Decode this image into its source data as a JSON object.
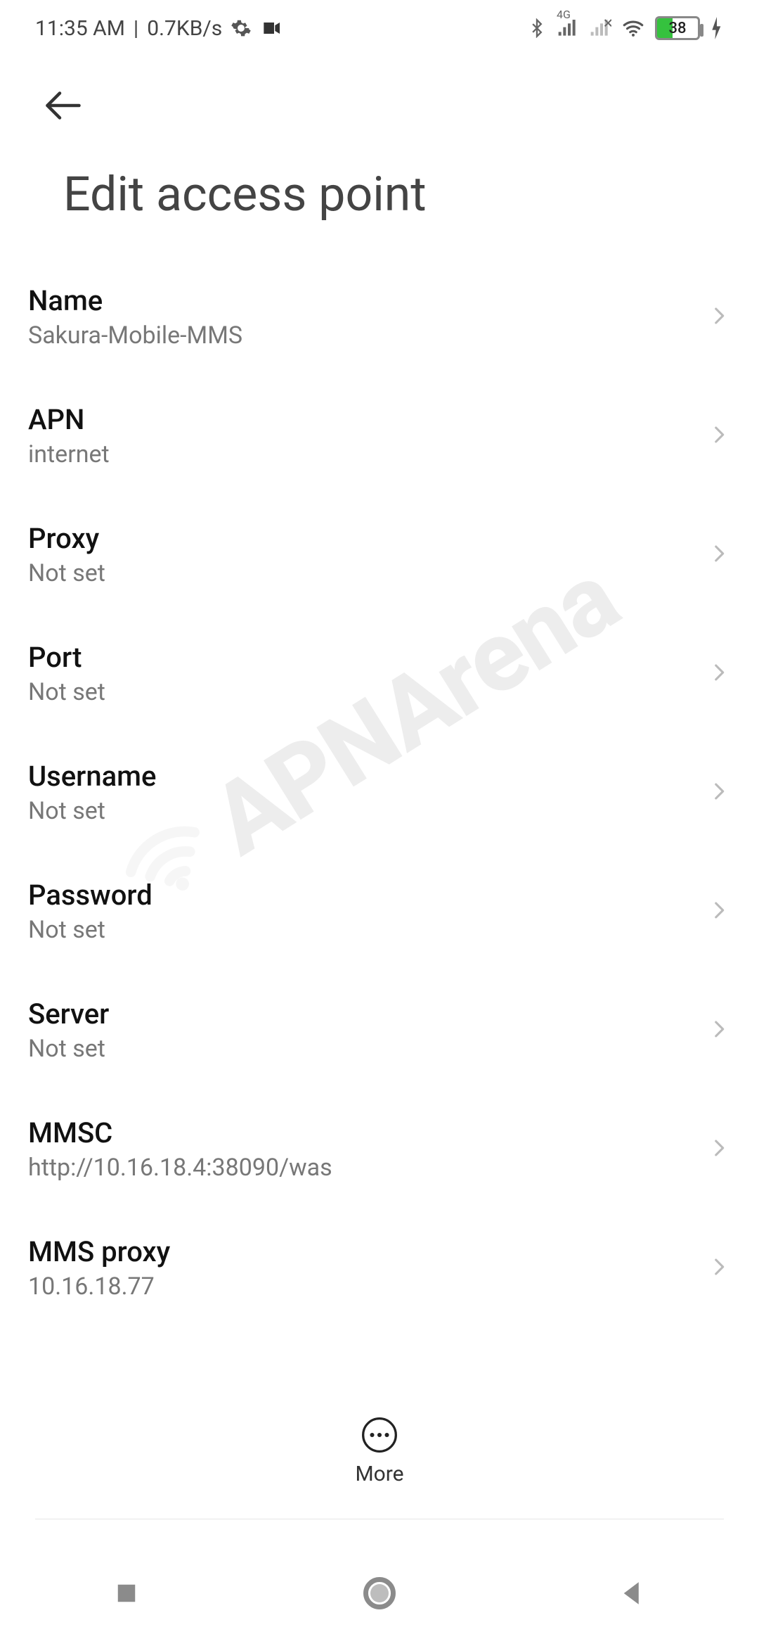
{
  "statusbar": {
    "time": "11:35 AM",
    "speed": "0.7KB/s",
    "battery_percent": "38",
    "network_label": "4G"
  },
  "header": {
    "title": "Edit access point"
  },
  "bottom": {
    "more_label": "More"
  },
  "items": [
    {
      "label": "Name",
      "value": "Sakura-Mobile-MMS"
    },
    {
      "label": "APN",
      "value": "internet"
    },
    {
      "label": "Proxy",
      "value": "Not set"
    },
    {
      "label": "Port",
      "value": "Not set"
    },
    {
      "label": "Username",
      "value": "Not set"
    },
    {
      "label": "Password",
      "value": "Not set"
    },
    {
      "label": "Server",
      "value": "Not set"
    },
    {
      "label": "MMSC",
      "value": "http://10.16.18.4:38090/was"
    },
    {
      "label": "MMS proxy",
      "value": "10.16.18.77"
    }
  ],
  "watermark": {
    "text": "APNArena"
  }
}
